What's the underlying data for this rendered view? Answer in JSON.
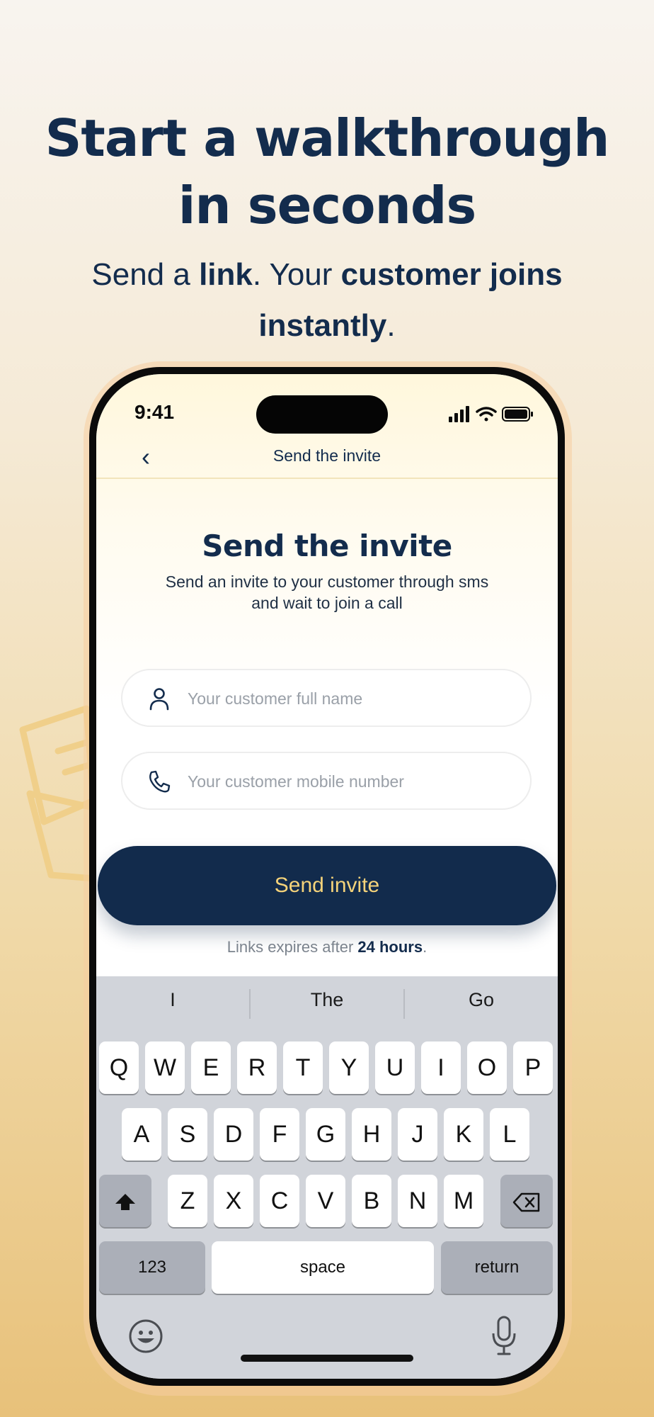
{
  "hero": {
    "title": "Start a walkthrough in seconds",
    "subtitle_parts": [
      "Send a ",
      "link",
      ". Your ",
      "customer joins instantly",
      "."
    ]
  },
  "status_bar": {
    "time": "9:41"
  },
  "nav": {
    "back_label": "‹",
    "title": "Send the invite"
  },
  "form": {
    "title": "Send the invite",
    "description": "Send an invite to your customer through sms and wait to join a call",
    "name_field": {
      "value": "",
      "placeholder": "Your customer full name",
      "icon": "person-icon"
    },
    "phone_field": {
      "value": "",
      "placeholder": "Your customer mobile number",
      "icon": "phone-icon"
    },
    "submit_label": "Send invite",
    "expiry_prefix": "Links expires after ",
    "expiry_value": "24 hours",
    "expiry_suffix": "."
  },
  "keyboard": {
    "suggestions": [
      "I",
      "The",
      "Go"
    ],
    "row1": [
      "Q",
      "W",
      "E",
      "R",
      "T",
      "Y",
      "U",
      "I",
      "O",
      "P"
    ],
    "row2": [
      "A",
      "S",
      "D",
      "F",
      "G",
      "H",
      "J",
      "K",
      "L"
    ],
    "row3": [
      "Z",
      "X",
      "C",
      "V",
      "B",
      "N",
      "M"
    ],
    "numbers_label": "123",
    "space_label": "space",
    "return_label": "return"
  },
  "colors": {
    "brand_navy": "#122b4c",
    "accent_yellow": "#f5d37a",
    "background_gold": "#e8c17a"
  }
}
